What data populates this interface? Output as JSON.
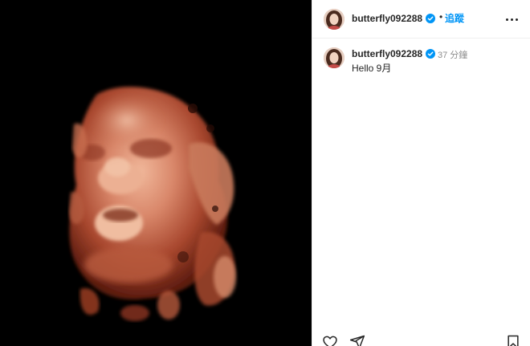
{
  "post": {
    "author": {
      "username": "butterfly092288",
      "verified": true,
      "avatar_icon": "profile-photo-avatar"
    },
    "header": {
      "separator": "•",
      "follow_label": "追蹤",
      "more_icon": "more-options-icon"
    },
    "caption": {
      "username": "butterfly092288",
      "timestamp": "37 分鐘",
      "text": "Hello 9月"
    },
    "media": {
      "type": "3d-ultrasound-image",
      "background_color": "#000000"
    },
    "actions": [
      {
        "icon": "heart-icon"
      },
      {
        "icon": "share-icon"
      },
      {
        "icon": "bookmark-icon"
      }
    ]
  },
  "colors": {
    "text": "#262626",
    "secondary_text": "#8e8e8e",
    "link": "#0095f6",
    "verified_badge": "#0095f6",
    "divider": "#efefef"
  }
}
